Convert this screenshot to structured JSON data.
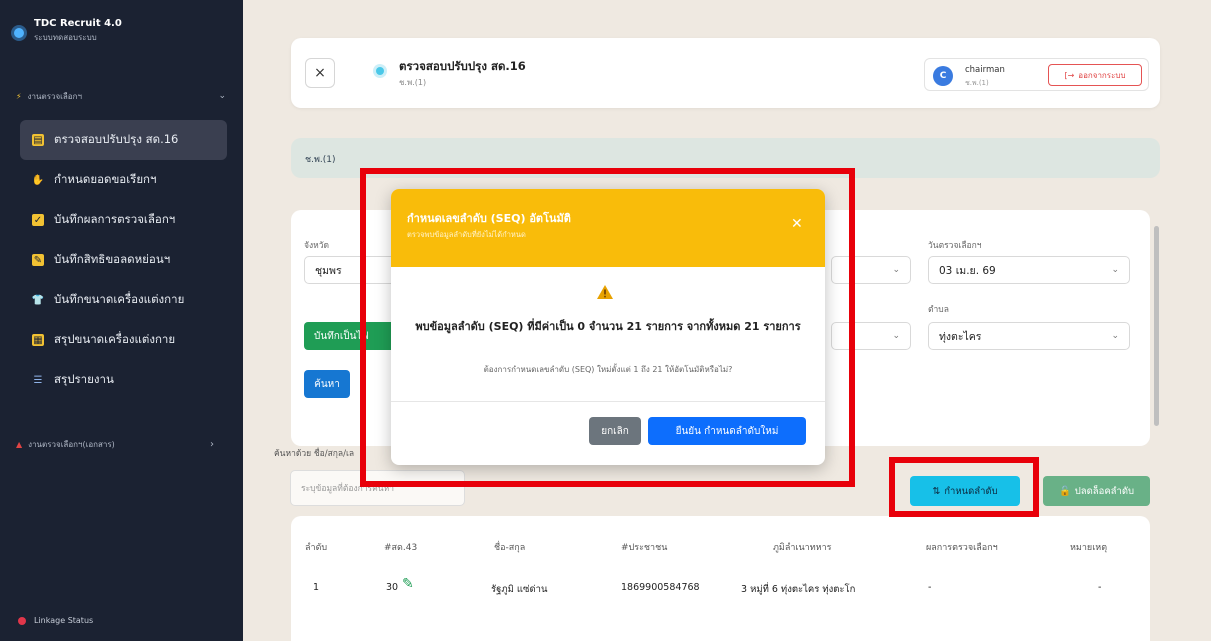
{
  "sidebar": {
    "app_title": "TDC Recruit 4.0",
    "app_subtitle": "ระบบทดสอบระบบ",
    "group_label": "งานตรวจเลือกฯ",
    "items": [
      {
        "label": "ตรวจสอบปรับปรุง สด.16",
        "icon_color": "#f2c233"
      },
      {
        "label": "กำหนดยอดขอเรียกฯ",
        "icon_color": "#f2c233"
      },
      {
        "label": "บันทึกผลการตรวจเลือกฯ",
        "icon_color": "#f2c233"
      },
      {
        "label": "บันทึกสิทธิขอลดหย่อนฯ",
        "icon_color": "#f2c233"
      },
      {
        "label": "บันทึกขนาดเครื่องแต่งกาย",
        "icon_color": "#f2c233"
      },
      {
        "label": "สรุปขนาดเครื่องแต่งกาย",
        "icon_color": "#f2c233"
      },
      {
        "label": "สรุปรายงาน",
        "icon_color": "#8fb3e8"
      }
    ],
    "group2_label": "งานตรวจเลือกฯ(เอกสาร)",
    "linkage": "Linkage Status"
  },
  "header": {
    "close": "×",
    "title": "ตรวจสอบปรับปรุง สด.16",
    "subtitle": "ช.พ.(1)",
    "user_initial": "C",
    "user_name": "chairman",
    "user_role": "ช.พ.(1)",
    "logout_label": "ออกจากระบบ"
  },
  "info_bar": {
    "text": "ช.พ.(1)"
  },
  "filters": {
    "province_label": "จังหวัด",
    "province_value": "ชุมพร",
    "date_label": "วันตรวจเลือกฯ",
    "date_value": "03 เม.ย. 69",
    "subdistrict_label": "ตำบล",
    "subdistrict_value": "ทุ่งตะไคร",
    "save_button": "บันทึกเป็นไฟ",
    "search_button": "ค้นหา"
  },
  "search": {
    "label": "ค้นหาด้วย ชื่อ/สกุล/เล",
    "placeholder": "ระบุข้อมูลที่ต้องการค้นหา"
  },
  "actions": {
    "set_seq": "กำหนดลำดับ",
    "unlock_seq": "ปลดล็อคลำดับ"
  },
  "table": {
    "headers": [
      "ลำดับ",
      "#สด.43",
      "ชื่อ-สกุล",
      "#ประชาชน",
      "ภูมิลำเนาทหาร",
      "ผลการตรวจเลือกฯ",
      "หมายเหตุ"
    ],
    "rows": [
      [
        "1",
        "30",
        "รัฐภูมิ แซ่ด่าน",
        "1869900584768",
        "3 หมู่ที่ 6 ทุ่งตะไคร ทุ่งตะโก",
        "-",
        "-"
      ]
    ]
  },
  "modal": {
    "title": "กำหนดเลขลำดับ (SEQ) อัตโนมัติ",
    "subtitle": "ตรวจพบข้อมูลลำดับที่ยังไม่ได้กำหนด",
    "message": "พบข้อมูลลำดับ (SEQ) ที่มีค่าเป็น 0 จำนวน 21 รายการ จากทั้งหมด 21 รายการ",
    "question": "ต้องการกำหนดเลขลำดับ (SEQ) ใหม่ตั้งแต่ 1 ถึง 21 ให้อัตโนมัติหรือไม่?",
    "cancel": "ยกเลิก",
    "confirm": "ยืนยัน กำหนดลำดับใหม่",
    "header_color": "#f9bc0a"
  }
}
